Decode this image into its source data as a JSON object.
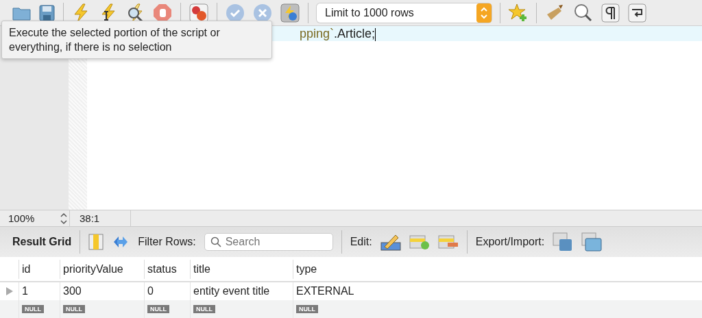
{
  "toolbar": {
    "limit_select": {
      "value": "Limit to 1000 rows"
    }
  },
  "tooltip": {
    "text": "Execute the selected portion of the script or everything, if there is no selection"
  },
  "editor": {
    "current_line": [
      {
        "text": "pping`",
        "kind": "identifier"
      },
      {
        "text": ".Article;",
        "kind": "plain"
      }
    ]
  },
  "status_bar": {
    "zoom": "100%",
    "cursor_position": "38:1"
  },
  "result_toolbar": {
    "title": "Result Grid",
    "filter_label": "Filter Rows:",
    "search": {
      "placeholder": "Search"
    },
    "edit_label": "Edit:",
    "export_label": "Export/Import:"
  },
  "table": {
    "columns": [
      "id",
      "priorityValue",
      "status",
      "title",
      "type"
    ],
    "rows": [
      {
        "current": true,
        "cells": [
          {
            "text": "1",
            "kind": "value"
          },
          {
            "text": "300",
            "kind": "value"
          },
          {
            "text": "0",
            "kind": "value"
          },
          {
            "text": "entity event title",
            "kind": "value"
          },
          {
            "text": "EXTERNAL",
            "kind": "value"
          }
        ]
      },
      {
        "current": false,
        "cells": [
          {
            "text": "NULL",
            "kind": "null"
          },
          {
            "text": "NULL",
            "kind": "null"
          },
          {
            "text": "NULL",
            "kind": "null"
          },
          {
            "text": "NULL",
            "kind": "null"
          },
          {
            "text": "NULL",
            "kind": "null"
          }
        ]
      }
    ]
  }
}
